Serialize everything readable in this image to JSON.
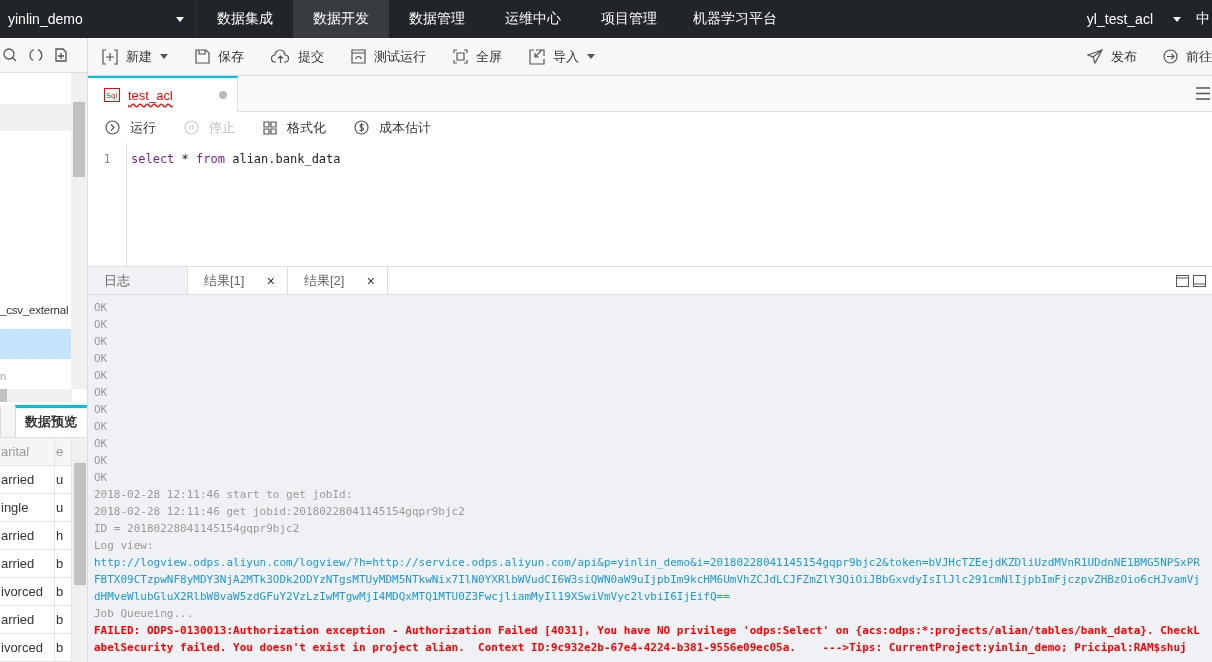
{
  "top_bar": {
    "project": "yinlin_demo",
    "nav": [
      {
        "label": "数据集成",
        "selected": false
      },
      {
        "label": "数据开发",
        "selected": true
      },
      {
        "label": "数据管理",
        "selected": false
      },
      {
        "label": "运维中心",
        "selected": false
      },
      {
        "label": "项目管理",
        "selected": false
      },
      {
        "label": "机器学习平台",
        "selected": false
      }
    ],
    "user": "yl_test_acl",
    "language": "中"
  },
  "sidebar": {
    "tree_items": [
      {
        "label": "_csv_external",
        "selected": false
      },
      {
        "selected": true
      },
      {
        "label": "n",
        "selected": false
      }
    ],
    "tabs": [
      {
        "selected": false
      },
      {
        "label": "数据预览",
        "selected": true
      }
    ],
    "table": {
      "columns": [
        "arital",
        "e"
      ],
      "rows": [
        [
          "arried",
          "u"
        ],
        [
          "ingle",
          "u"
        ],
        [
          "arried",
          "h"
        ],
        [
          "arried",
          "b"
        ],
        [
          "ivorced",
          "b"
        ],
        [
          "arried",
          "b"
        ],
        [
          "ivorced",
          "b"
        ]
      ]
    }
  },
  "toolbar": {
    "left": [
      {
        "label": "新建",
        "kind": "new",
        "dropdown": true
      },
      {
        "label": "保存",
        "kind": "save",
        "dropdown": false
      },
      {
        "label": "提交",
        "kind": "submit",
        "dropdown": false
      },
      {
        "label": "测试运行",
        "kind": "test",
        "dropdown": false
      },
      {
        "label": "全屏",
        "kind": "fullscreen",
        "dropdown": false
      },
      {
        "label": "导入",
        "kind": "import",
        "dropdown": true
      }
    ],
    "right": [
      {
        "label": "发布",
        "kind": "publish"
      },
      {
        "label": "前往",
        "kind": "goto"
      }
    ]
  },
  "file_tab": {
    "icon_text": "Sql",
    "title": "test_acl",
    "unsaved": true
  },
  "actions": [
    {
      "label": "运行",
      "kind": "run",
      "disabled": false
    },
    {
      "label": "停止",
      "kind": "stop",
      "disabled": true
    },
    {
      "label": "格式化",
      "kind": "format",
      "disabled": false
    },
    {
      "label": "成本估计",
      "kind": "cost",
      "disabled": false
    }
  ],
  "editor": {
    "lines": [
      {
        "number": "1",
        "tokens": [
          {
            "text": "select",
            "kind": "keyword"
          },
          {
            "text": " * ",
            "kind": "plain"
          },
          {
            "text": "from",
            "kind": "keyword"
          },
          {
            "text": " alian.bank_data",
            "kind": "plain"
          }
        ]
      }
    ]
  },
  "result_tabs": [
    {
      "label": "日志",
      "selected": true
    },
    {
      "label": "结果[1]",
      "selected": false,
      "close": "×"
    },
    {
      "label": "结果[2]",
      "selected": false,
      "close": "×"
    }
  ],
  "log": [
    {
      "kind": "info",
      "text": "OK"
    },
    {
      "kind": "info",
      "text": "OK"
    },
    {
      "kind": "info",
      "text": "OK"
    },
    {
      "kind": "info",
      "text": "OK"
    },
    {
      "kind": "info",
      "text": "OK"
    },
    {
      "kind": "info",
      "text": "OK"
    },
    {
      "kind": "info",
      "text": "OK"
    },
    {
      "kind": "info",
      "text": "OK"
    },
    {
      "kind": "info",
      "text": "OK"
    },
    {
      "kind": "info",
      "text": "OK"
    },
    {
      "kind": "info",
      "text": "OK"
    },
    {
      "kind": "info",
      "text": "2018-02-28 12:11:46 start to get jobId:"
    },
    {
      "kind": "info",
      "text": "2018-02-28 12:11:46 get jobid:20180228041145154gqpr9bjc2"
    },
    {
      "kind": "info",
      "text": "ID = 20180228041145154gqpr9bjc2"
    },
    {
      "kind": "info",
      "text": "Log view:"
    },
    {
      "kind": "link",
      "text": "http://logview.odps.aliyun.com/logview/?h=http://service.odps.aliyun.com/api&p=yinlin_demo&i=20180228041145154gqpr9bjc2&token=bVJHcTZEejdKZDliUzdMVnR1UDdnNE1BMG5NPSxPRFBTX09CTzpwNF8yMDY3NjA2MTk3ODk2ODYzNTgsMTUyMDM5NTkwNix7IlN0YXRlbWVudCI6W3siQWN0aW9uIjpbIm9kcHM6UmVhZCJdLCJFZmZlY3QiOiJBbGxvdyIsIlJlc291cmNlIjpbImFjczpvZHBzOio6cHJvamVjdHMveWlubGluX2RlbW8vaW5zdGFuY2VzLzIwMTgwMjI4MDQxMTQ1MTU0Z3FwcjliamMyIl19XSwiVmVyc2lvbiI6IjEifQ=="
    },
    {
      "kind": "info",
      "text": "Job Queueing..."
    },
    {
      "kind": "error",
      "text": "FAILED: ODPS-0130013:Authorization exception - Authorization Failed [4031], You have NO privilege 'odps:Select' on {acs:odps:*:projects/alian/tables/bank_data}. CheckLabelSecurity failed. You doesn't exist in project alian.  Context ID:9c932e2b-67e4-4224-b381-9556e09ec05a.    --->Tips: CurrentProject:yinlin_demo; Pricipal:RAM$shuj"
    }
  ]
}
